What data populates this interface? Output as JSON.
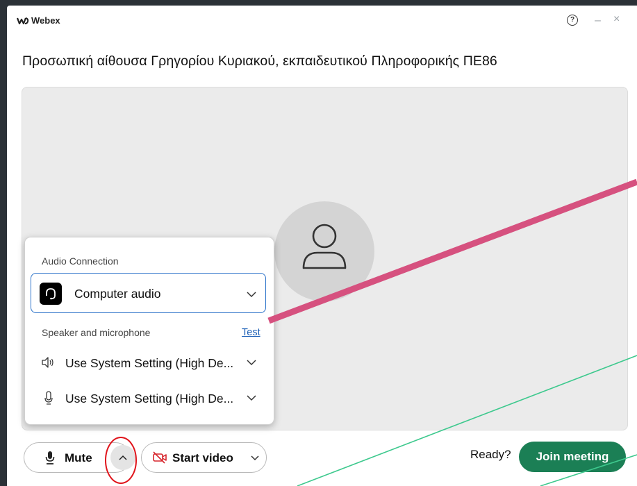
{
  "window": {
    "app_name": "Webex",
    "help_symbol": "?",
    "minimize_symbol": "–",
    "close_symbol": "×"
  },
  "meeting": {
    "title": "Προσωπική αίθουσα Γρηγορίου Κυριακού, εκπαιδευτικού Πληροφορικής ΠΕ86"
  },
  "audio_panel": {
    "connection_label": "Audio Connection",
    "connection_value": "Computer audio",
    "speaker_mic_label": "Speaker and microphone",
    "test_link": "Test",
    "speaker_value": "Use System Setting (High De...",
    "microphone_value": "Use System Setting (High De..."
  },
  "controls": {
    "mute_label": "Mute",
    "start_video_label": "Start video",
    "ready_label": "Ready?",
    "join_label": "Join meeting"
  },
  "icons": {
    "logo": "webex-logo-icon",
    "help": "help-icon",
    "minimize": "minimize-icon",
    "close": "close-icon",
    "avatar": "user-avatar-icon",
    "headset": "headset-icon",
    "speaker": "speaker-icon",
    "microphone": "microphone-icon",
    "chevron": "chevron-down-icon",
    "chevron_up": "chevron-up-icon",
    "video_off": "video-off-icon"
  },
  "colors": {
    "join_button": "#1b7f55",
    "link": "#1b5fb6",
    "select_border": "#2b72c9",
    "annotation_line": "#d6517f",
    "annotation_circle": "#e0141b",
    "annotation_thin_lines": "#3ec98e"
  }
}
